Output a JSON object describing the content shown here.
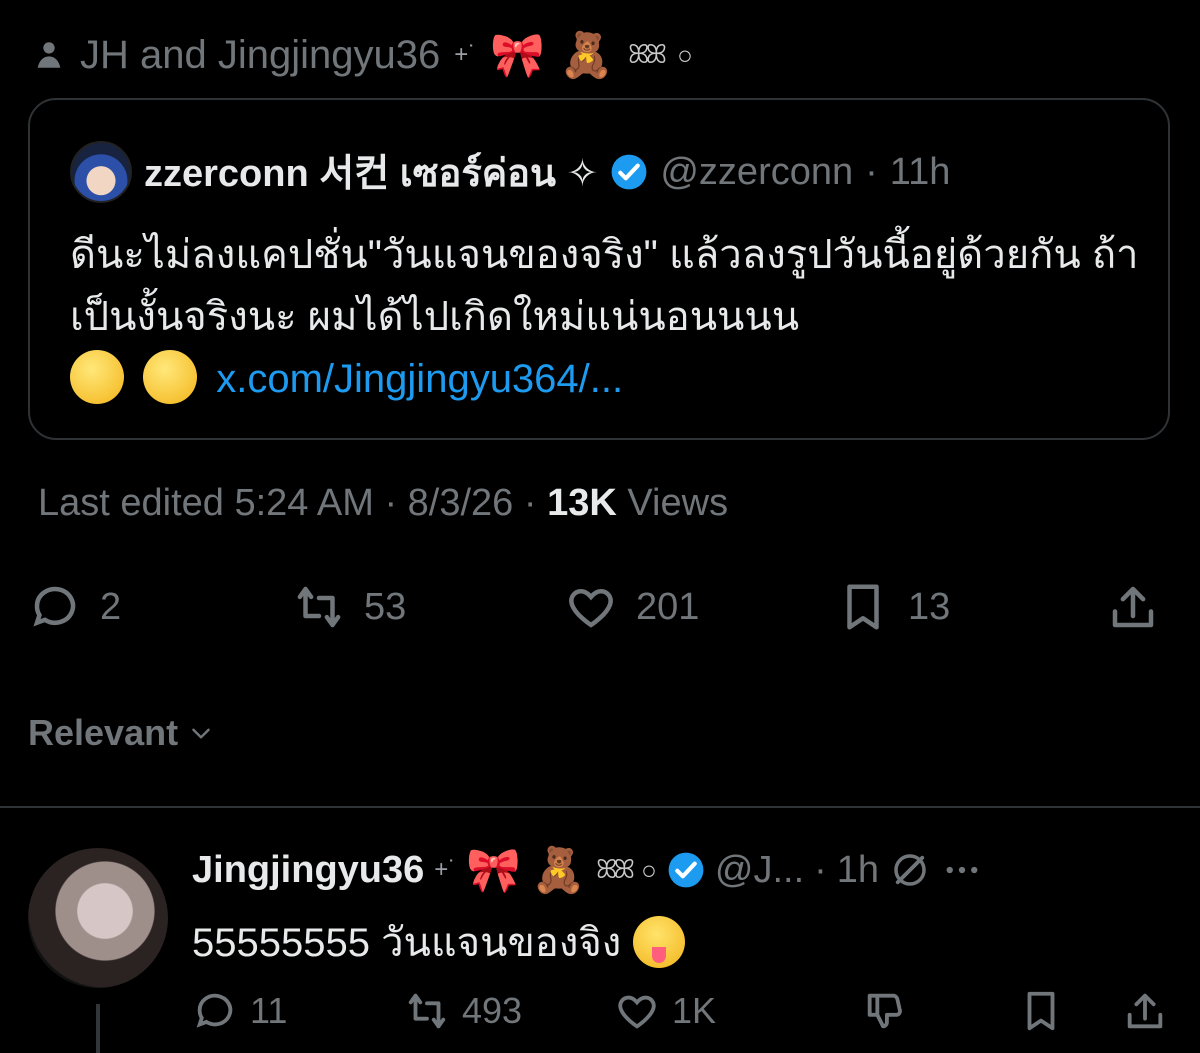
{
  "social_context": {
    "text": "JH and Jingjingyu36",
    "small_mark": "+˙",
    "ribbon": "🎀",
    "bear": "🧸",
    "swirl": "ꕤꕤ",
    "ring": "○"
  },
  "quoted_post": {
    "display_name": "zzerconn 서컨 เซอร์ค่อน ✧",
    "handle": "@zzerconn",
    "separator": "·",
    "time": "11h",
    "text": "ดีนะไม่ลงแคปชั่น\"วันแจนของจริง\" แล้วลงรูปวันนี้อยู่ด้วยกัน ถ้าเป็นงั้นจริงนะ ผมได้ไปเกิดใหม่แน่นอนนนน",
    "link": "x.com/Jingjingyu364/..."
  },
  "meta": {
    "edited": "Last edited 5:24 AM · 8/3/26",
    "separator": "·",
    "views_count": "13K",
    "views_label": "Views"
  },
  "actions": {
    "replies": "2",
    "reposts": "53",
    "likes": "201",
    "bookmarks": "13"
  },
  "sort": {
    "label": "Relevant"
  },
  "reply": {
    "display_name": "Jingjingyu36",
    "small_mark": "+˙",
    "ribbon": "🎀",
    "bear": "🧸",
    "swirl": "ꕤꕤ",
    "ring": "○",
    "handle": "@J...",
    "separator": "·",
    "time": "1h",
    "text": "55555555 วันแจนของจิง",
    "actions": {
      "replies": "11",
      "reposts": "493",
      "likes": "1K"
    }
  },
  "colors": {
    "background": "#000000",
    "text": "#e7e9ea",
    "muted": "#71767b",
    "link": "#1d9bf0",
    "border": "#2f3336"
  }
}
